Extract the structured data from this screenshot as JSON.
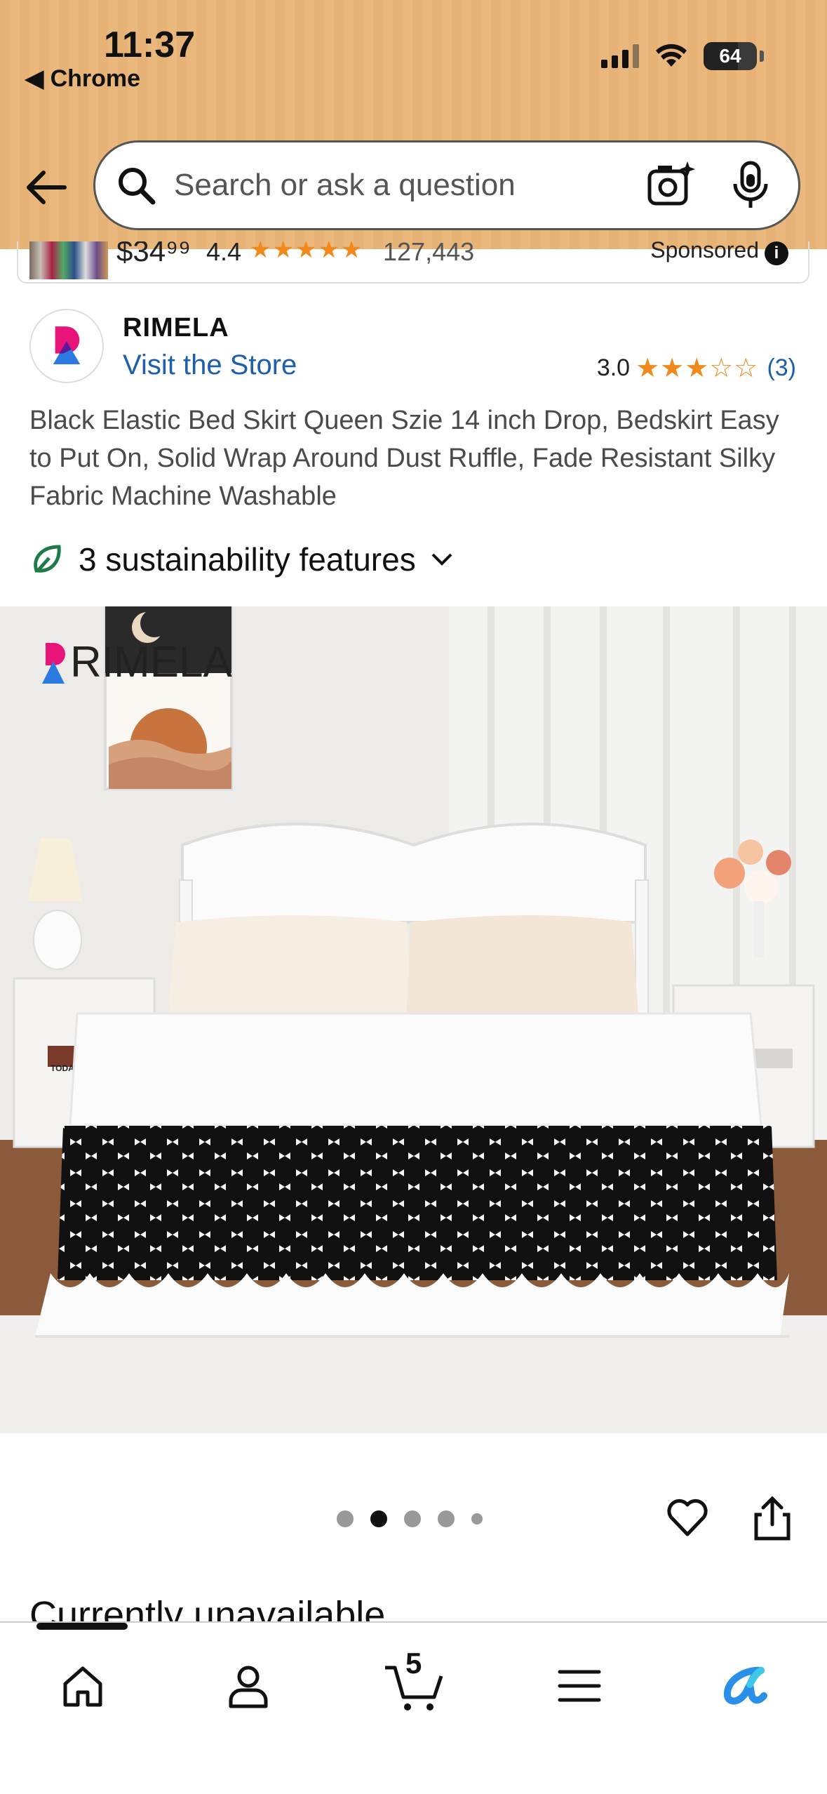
{
  "status_bar": {
    "time": "11:37",
    "back_app": "◀ Chrome",
    "battery": "64"
  },
  "search": {
    "placeholder": "Search or ask a question"
  },
  "sponsored_item": {
    "price": "$34⁹⁹",
    "rating": "4.4",
    "stars": "★★★★★",
    "review_count": "127,443",
    "label": "Sponsored"
  },
  "store": {
    "name": "RIMELA",
    "link": "Visit the Store",
    "rating": "3.0",
    "stars": "★★★☆☆",
    "review_count": "(3)"
  },
  "product": {
    "title": "Black Elastic Bed Skirt Queen Szie 14 inch Drop, Bedskirt Easy to Put On, Solid Wrap Around Dust Ruffle, Fade Resistant Silky Fabric Machine Washable",
    "sustainability": "3 sustainability features",
    "image_brand": "RIMELA",
    "book_label": "TODAY IS A"
  },
  "carousel": {
    "count": 5,
    "active_index": 1
  },
  "availability": "Currently unavailable",
  "tabbar": {
    "cart_count": "5",
    "items": [
      "home",
      "account",
      "cart",
      "menu",
      "rufus"
    ]
  },
  "colors": {
    "header": "#e8b57a",
    "link": "#1d5fa8",
    "star": "#f08a1c",
    "leaf": "#1f7a4a"
  }
}
